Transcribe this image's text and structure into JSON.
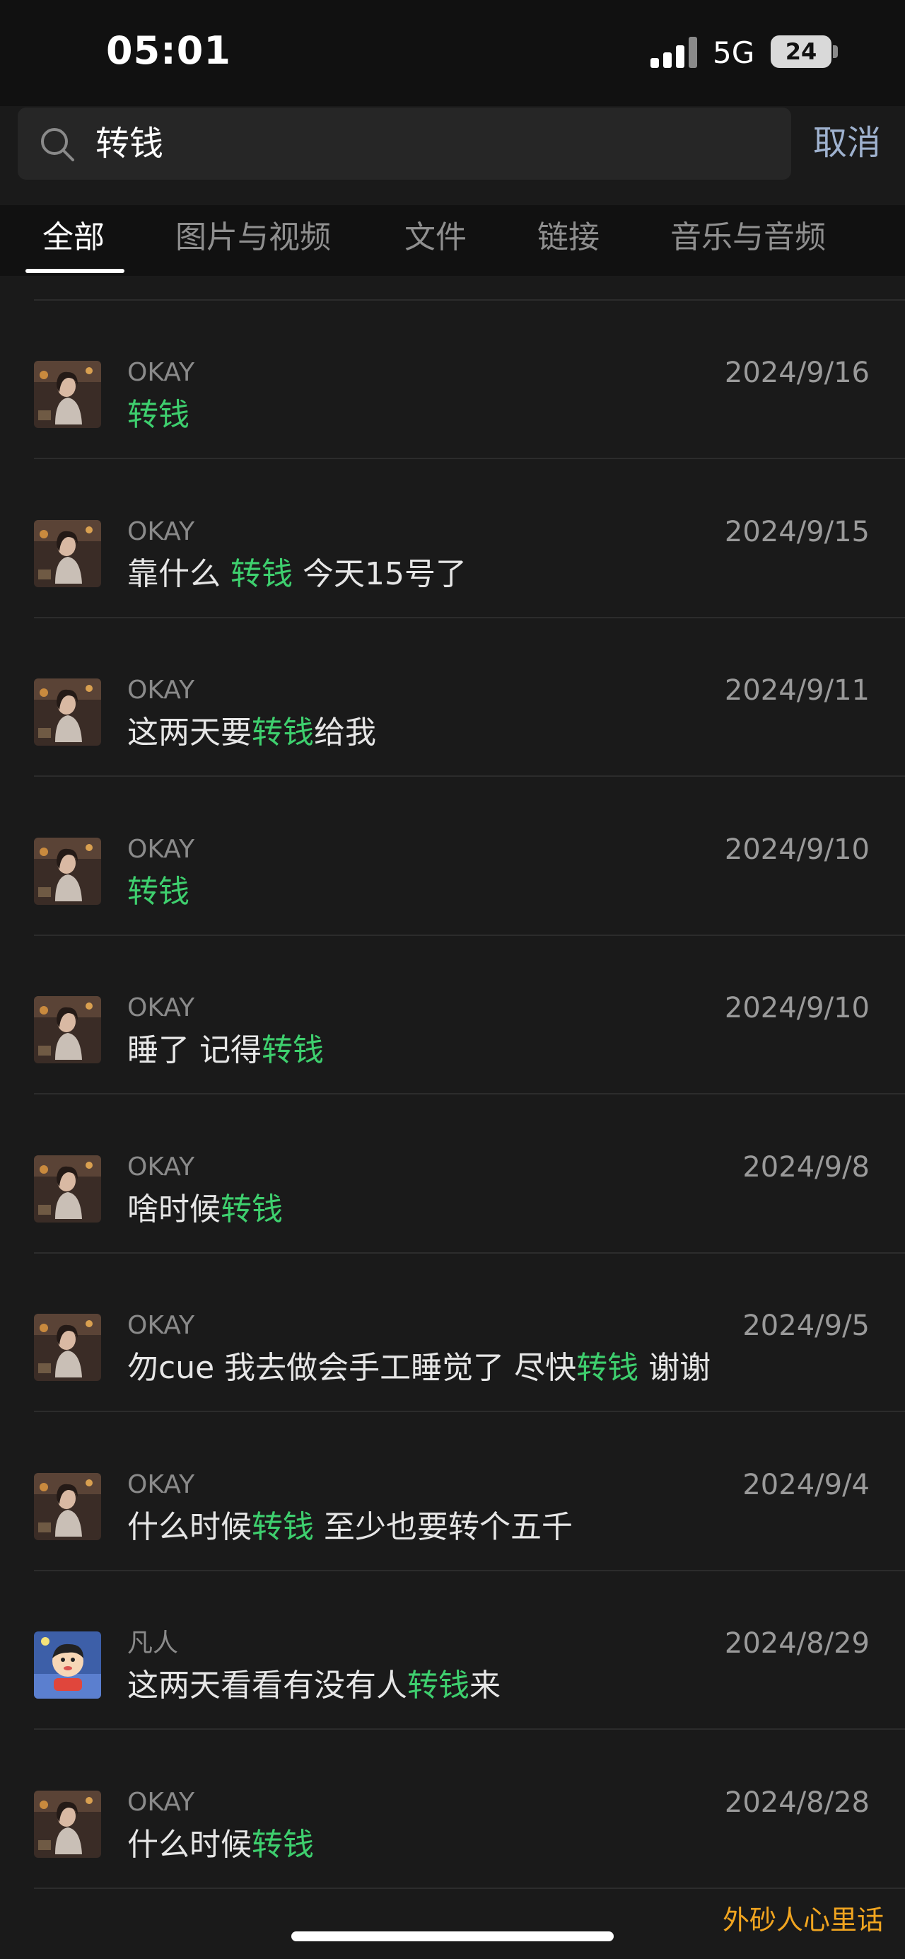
{
  "status_bar": {
    "time": "05:01",
    "network": "5G",
    "battery": "24"
  },
  "search": {
    "query": "转钱",
    "cancel_label": "取消"
  },
  "tabs": [
    {
      "label": "全部",
      "active": true
    },
    {
      "label": "图片与视频",
      "active": false
    },
    {
      "label": "文件",
      "active": false
    },
    {
      "label": "链接",
      "active": false
    },
    {
      "label": "音乐与音频",
      "active": false
    }
  ],
  "results": [
    {
      "avatar": "okay-avatar",
      "name": "OKAY",
      "date": "2024/9/16",
      "before": "",
      "keyword": "转钱",
      "after": ""
    },
    {
      "avatar": "okay-avatar",
      "name": "OKAY",
      "date": "2024/9/15",
      "before": "靠什么 ",
      "keyword": "转钱",
      "after": " 今天15号了"
    },
    {
      "avatar": "okay-avatar",
      "name": "OKAY",
      "date": "2024/9/11",
      "before": "这两天要",
      "keyword": "转钱",
      "after": "给我"
    },
    {
      "avatar": "okay-avatar",
      "name": "OKAY",
      "date": "2024/9/10",
      "before": "",
      "keyword": "转钱",
      "after": ""
    },
    {
      "avatar": "okay-avatar",
      "name": "OKAY",
      "date": "2024/9/10",
      "before": "睡了 记得",
      "keyword": "转钱",
      "after": ""
    },
    {
      "avatar": "okay-avatar",
      "name": "OKAY",
      "date": "2024/9/8",
      "before": "啥时候",
      "keyword": "转钱",
      "after": ""
    },
    {
      "avatar": "okay-avatar",
      "name": "OKAY",
      "date": "2024/9/5",
      "before": "勿cue 我去做会手工睡觉了 尽快",
      "keyword": "转钱",
      "after": " 谢谢"
    },
    {
      "avatar": "okay-avatar",
      "name": "OKAY",
      "date": "2024/9/4",
      "before": "什么时候",
      "keyword": "转钱",
      "after": " 至少也要转个五千"
    },
    {
      "avatar": "cartoon-avatar",
      "name": "凡人",
      "date": "2024/8/29",
      "before": "这两天看看有没有人",
      "keyword": "转钱",
      "after": "来"
    },
    {
      "avatar": "okay-avatar",
      "name": "OKAY",
      "date": "2024/8/28",
      "before": "什么时候",
      "keyword": "转钱",
      "after": ""
    }
  ],
  "watermark": "外砂人心里话",
  "colors": {
    "highlight": "#3ecf6e",
    "background": "#1a1a1a",
    "cancel": "#9fb2cf",
    "watermark": "#f1a520"
  }
}
